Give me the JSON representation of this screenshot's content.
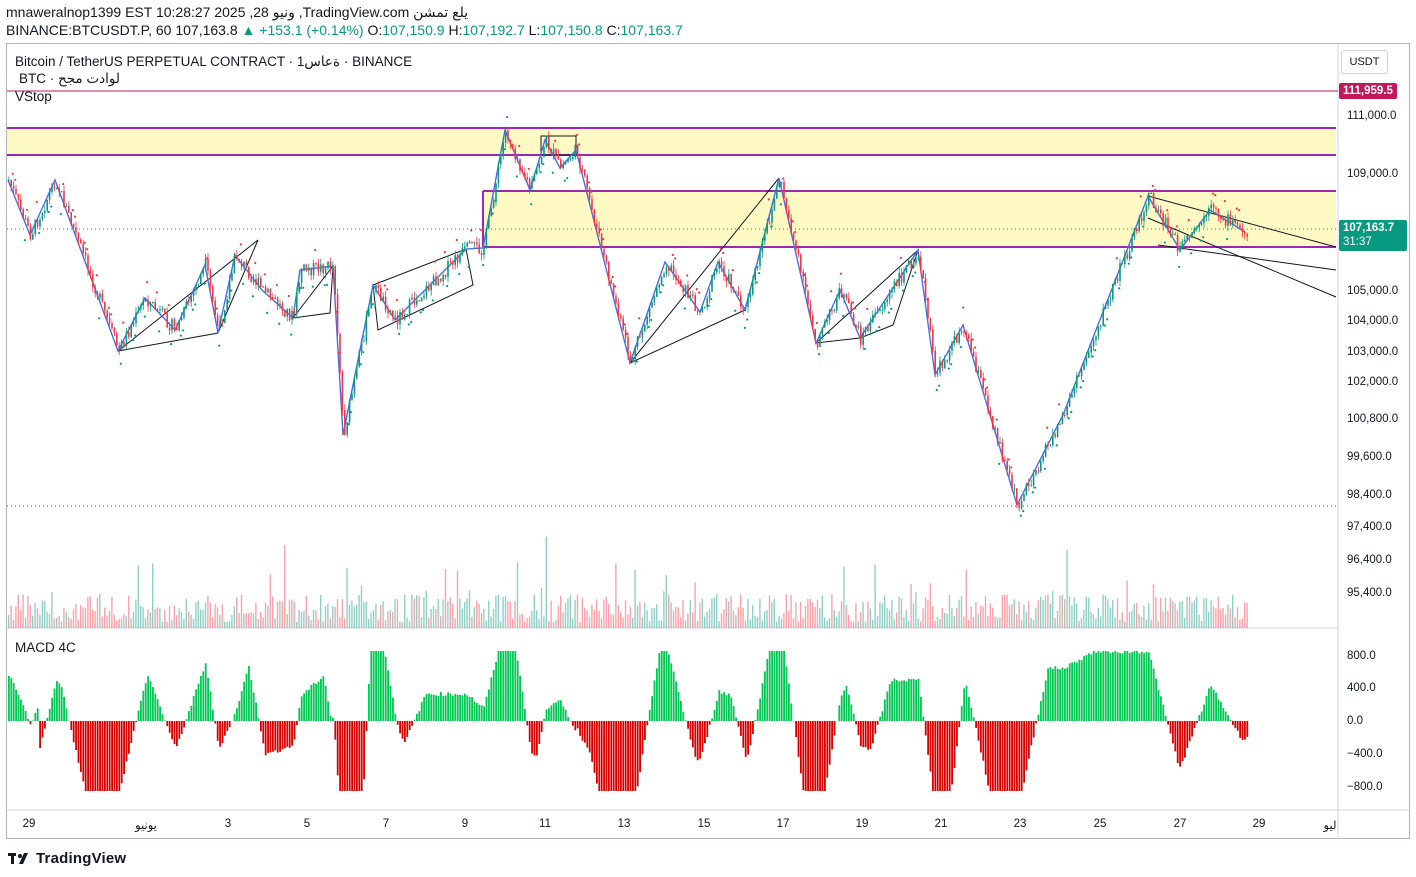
{
  "header": {
    "line1": "mnaweralnop1399 EST 10:28:27 2025 ,28 ونيو ,TradingView.com يلع تمشن",
    "symbol": "BINANCE:BTCUSDT.P, 60",
    "price": "107,163.8",
    "change": "+153.1 (+0.14%)",
    "open_label": "O:",
    "open": "107,150.9",
    "high_label": "H:",
    "high": "107,192.7",
    "low_label": "L:",
    "low": "107,150.8",
    "close_label": "C:",
    "close": "107,163.7"
  },
  "legend": {
    "title": "Bitcoin / TetherUS PERPETUAL CONTRACT · 1ةعاس · BINANCE",
    "subtitle": "BTC · لوادت مجح",
    "indicator": "VStop",
    "macd": "MACD 4C"
  },
  "price_scale": {
    "currency": "USDT",
    "ticks": [
      "111,000.0",
      "109,000.0",
      "105,000.0",
      "104,000.0",
      "103,000.0",
      "102,000.0",
      "100,800.0",
      "99,600.0",
      "98,400.0",
      "97,400.0",
      "96,400.0",
      "95,400.0"
    ],
    "macd_ticks": [
      "800.0",
      "400.0",
      "0.0",
      "−400.0",
      "−800.0"
    ],
    "level_tag": "111,959.5",
    "last_price": "107,163.7",
    "countdown": "31:37"
  },
  "time_scale": {
    "labels": [
      "29",
      "يونيو",
      "3",
      "5",
      "7",
      "9",
      "11",
      "13",
      "15",
      "17",
      "19",
      "21",
      "23",
      "25",
      "27",
      "29",
      "ليو"
    ]
  },
  "colors": {
    "up": "#089981",
    "down": "#f23645",
    "pattern": "#4a6fe3",
    "zone": "#fff9c4",
    "zone_border": "#9c27b0",
    "macd_up": "#00c853",
    "macd_down": "#d50000"
  },
  "branding": {
    "logo": "TradingView",
    "logo_icon": "tradingview-logo-icon"
  }
}
